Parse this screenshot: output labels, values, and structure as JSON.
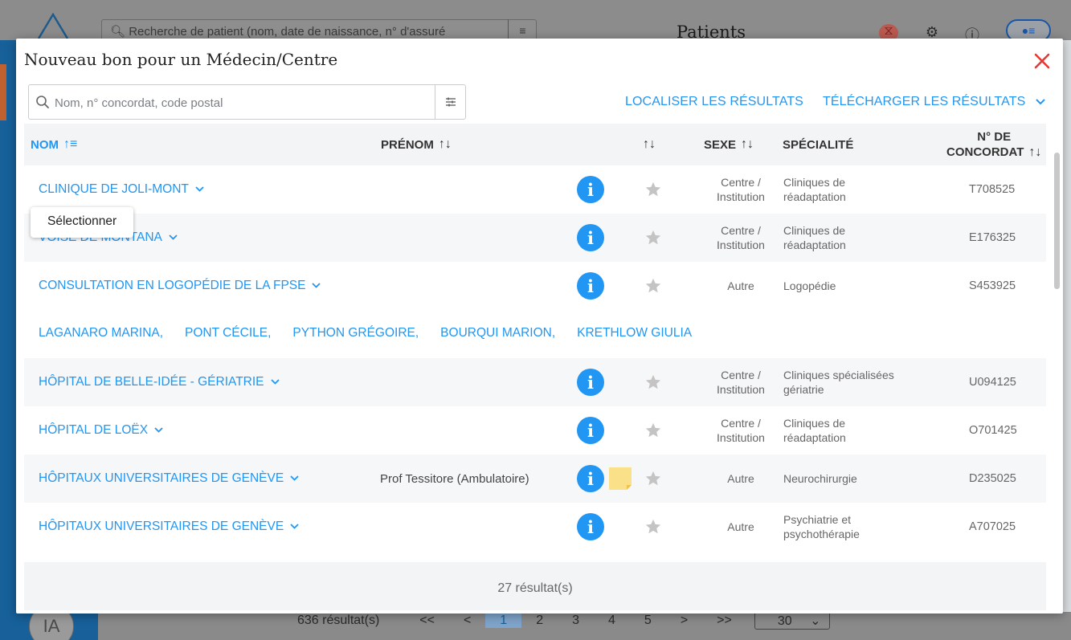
{
  "background": {
    "search_placeholder": "Recherche de patient (nom, date de naissance, n° d'assuré",
    "page_title": "Patients",
    "avatar_initials": "IA",
    "pagination": {
      "results": "636 résultat(s)",
      "first": "<<",
      "prev": "<",
      "pages": [
        "1",
        "2",
        "3",
        "4",
        "5"
      ],
      "next": ">",
      "last": ">>",
      "page_size": "30"
    }
  },
  "modal": {
    "title": "Nouveau bon pour un Médecin/Centre",
    "search_placeholder": "Nom, n° concordat, code postal",
    "search_value": "",
    "localiser_label": "LOCALISER LES RÉSULTATS",
    "telecharger_label": "TÉLÉCHARGER LES RÉSULTATS",
    "columns": {
      "nom": "NOM",
      "prenom": "PRÉNOM",
      "sexe": "SEXE",
      "specialite": "SPÉCIALITÉ",
      "concordat_line1": "N° DE",
      "concordat_line2": "CONCORDAT"
    },
    "rows": [
      {
        "name": "CLINIQUE DE JOLI-MONT",
        "prenom": "",
        "sexe_1": "Centre /",
        "sexe_2": "Institution",
        "spec_1": "Cliniques de",
        "spec_2": "réadaptation",
        "concordat": "T708525"
      },
      {
        "name": "VOISE DE MONTANA",
        "prenom": "",
        "sexe_1": "Centre /",
        "sexe_2": "Institution",
        "spec_1": "Cliniques de",
        "spec_2": "réadaptation",
        "concordat": "E176325"
      },
      {
        "name": "CONSULTATION EN LOGOPÉDIE DE LA FPSE",
        "prenom": "",
        "sexe_1": "Autre",
        "sexe_2": "",
        "spec_1": "Logopédie",
        "spec_2": "",
        "concordat": "S453925"
      },
      {
        "name": "HÔPITAL DE BELLE-IDÉE - GÉRIATRIE",
        "prenom": "",
        "sexe_1": "Centre /",
        "sexe_2": "Institution",
        "spec_1": "Cliniques spécialisées",
        "spec_2": "gériatrie",
        "concordat": "U094125"
      },
      {
        "name": "HÔPITAL DE LOËX",
        "prenom": "",
        "sexe_1": "Centre /",
        "sexe_2": "Institution",
        "spec_1": "Cliniques de",
        "spec_2": "réadaptation",
        "concordat": "O701425"
      },
      {
        "name": "HÔPITAUX UNIVERSITAIRES DE GENÈVE",
        "prenom": "Prof Tessitore (Ambulatoire)",
        "sexe_1": "Autre",
        "sexe_2": "",
        "spec_1": "Neurochirurgie",
        "spec_2": "",
        "concordat": "D235025"
      },
      {
        "name": "HÔPITAUX UNIVERSITAIRES DE GENÈVE",
        "prenom": "",
        "sexe_1": "Autre",
        "sexe_2": "",
        "spec_1": "Psychiatrie et",
        "spec_2": "psychothérapie",
        "concordat": "A707025"
      }
    ],
    "group_members": [
      "LAGANARO MARINA,",
      "PONT CÉCILE,",
      "PYTHON GRÉGOIRE,",
      "BOURQUI MARION,",
      "KRETHLOW GIULIA"
    ],
    "result_count": "27 résultat(s)",
    "tooltip": "Sélectionner"
  },
  "colors": {
    "accent": "#2196f3",
    "close": "#e53935",
    "note": "#fbe08a",
    "star": "#c4c4c4"
  }
}
